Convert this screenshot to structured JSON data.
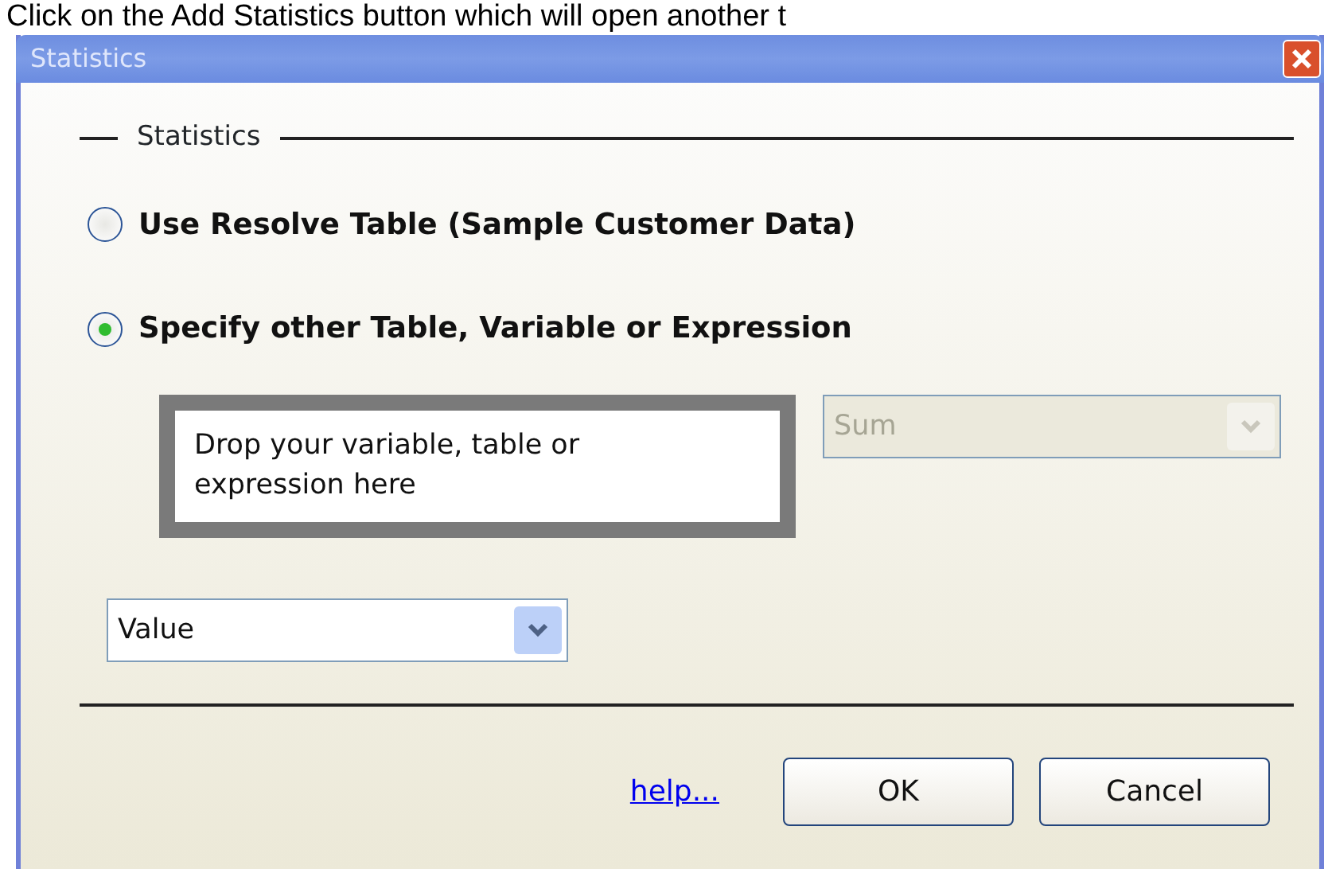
{
  "caption": "Click on the Add Statistics button which will open another t",
  "window": {
    "title": "Statistics"
  },
  "group": {
    "label": "Statistics"
  },
  "radios": [
    {
      "label": "Use Resolve Table (Sample Customer Data)",
      "selected": false
    },
    {
      "label": "Specify other Table, Variable or Expression",
      "selected": true
    }
  ],
  "drop_zone": {
    "text": "Drop your variable, table or expression here"
  },
  "aggregate_dropdown": {
    "value": "Sum",
    "disabled": true
  },
  "value_dropdown": {
    "value": "Value",
    "disabled": false
  },
  "help_link": "help...",
  "buttons": [
    {
      "label": "OK"
    },
    {
      "label": "Cancel"
    }
  ]
}
